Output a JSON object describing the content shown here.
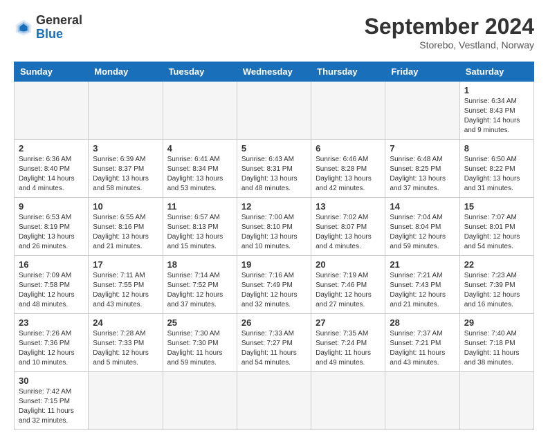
{
  "header": {
    "logo_line1": "General",
    "logo_line2": "Blue",
    "month_title": "September 2024",
    "location": "Storebo, Vestland, Norway"
  },
  "calendar": {
    "days_of_week": [
      "Sunday",
      "Monday",
      "Tuesday",
      "Wednesday",
      "Thursday",
      "Friday",
      "Saturday"
    ],
    "weeks": [
      [
        null,
        null,
        null,
        null,
        null,
        null,
        {
          "day": "1",
          "sunrise": "Sunrise: 6:34 AM",
          "sunset": "Sunset: 8:43 PM",
          "daylight": "Daylight: 14 hours and 9 minutes."
        }
      ],
      [
        {
          "day": "2",
          "sunrise": "Sunrise: 6:36 AM",
          "sunset": "Sunset: 8:40 PM",
          "daylight": "Daylight: 14 hours and 4 minutes."
        },
        {
          "day": "3",
          "sunrise": "Sunrise: 6:39 AM",
          "sunset": "Sunset: 8:37 PM",
          "daylight": "Daylight: 13 hours and 58 minutes."
        },
        {
          "day": "4",
          "sunrise": "Sunrise: 6:41 AM",
          "sunset": "Sunset: 8:34 PM",
          "daylight": "Daylight: 13 hours and 53 minutes."
        },
        {
          "day": "5",
          "sunrise": "Sunrise: 6:43 AM",
          "sunset": "Sunset: 8:31 PM",
          "daylight": "Daylight: 13 hours and 48 minutes."
        },
        {
          "day": "6",
          "sunrise": "Sunrise: 6:46 AM",
          "sunset": "Sunset: 8:28 PM",
          "daylight": "Daylight: 13 hours and 42 minutes."
        },
        {
          "day": "7",
          "sunrise": "Sunrise: 6:48 AM",
          "sunset": "Sunset: 8:25 PM",
          "daylight": "Daylight: 13 hours and 37 minutes."
        },
        {
          "day": "8",
          "sunrise": "Sunrise: 6:50 AM",
          "sunset": "Sunset: 8:22 PM",
          "daylight": "Daylight: 13 hours and 31 minutes."
        }
      ],
      [
        {
          "day": "9",
          "sunrise": "Sunrise: 6:53 AM",
          "sunset": "Sunset: 8:19 PM",
          "daylight": "Daylight: 13 hours and 26 minutes."
        },
        {
          "day": "10",
          "sunrise": "Sunrise: 6:55 AM",
          "sunset": "Sunset: 8:16 PM",
          "daylight": "Daylight: 13 hours and 21 minutes."
        },
        {
          "day": "11",
          "sunrise": "Sunrise: 6:57 AM",
          "sunset": "Sunset: 8:13 PM",
          "daylight": "Daylight: 13 hours and 15 minutes."
        },
        {
          "day": "12",
          "sunrise": "Sunrise: 7:00 AM",
          "sunset": "Sunset: 8:10 PM",
          "daylight": "Daylight: 13 hours and 10 minutes."
        },
        {
          "day": "13",
          "sunrise": "Sunrise: 7:02 AM",
          "sunset": "Sunset: 8:07 PM",
          "daylight": "Daylight: 13 hours and 4 minutes."
        },
        {
          "day": "14",
          "sunrise": "Sunrise: 7:04 AM",
          "sunset": "Sunset: 8:04 PM",
          "daylight": "Daylight: 12 hours and 59 minutes."
        },
        {
          "day": "15",
          "sunrise": "Sunrise: 7:07 AM",
          "sunset": "Sunset: 8:01 PM",
          "daylight": "Daylight: 12 hours and 54 minutes."
        }
      ],
      [
        {
          "day": "16",
          "sunrise": "Sunrise: 7:09 AM",
          "sunset": "Sunset: 7:58 PM",
          "daylight": "Daylight: 12 hours and 48 minutes."
        },
        {
          "day": "17",
          "sunrise": "Sunrise: 7:11 AM",
          "sunset": "Sunset: 7:55 PM",
          "daylight": "Daylight: 12 hours and 43 minutes."
        },
        {
          "day": "18",
          "sunrise": "Sunrise: 7:14 AM",
          "sunset": "Sunset: 7:52 PM",
          "daylight": "Daylight: 12 hours and 37 minutes."
        },
        {
          "day": "19",
          "sunrise": "Sunrise: 7:16 AM",
          "sunset": "Sunset: 7:49 PM",
          "daylight": "Daylight: 12 hours and 32 minutes."
        },
        {
          "day": "20",
          "sunrise": "Sunrise: 7:19 AM",
          "sunset": "Sunset: 7:46 PM",
          "daylight": "Daylight: 12 hours and 27 minutes."
        },
        {
          "day": "21",
          "sunrise": "Sunrise: 7:21 AM",
          "sunset": "Sunset: 7:43 PM",
          "daylight": "Daylight: 12 hours and 21 minutes."
        },
        {
          "day": "22",
          "sunrise": "Sunrise: 7:23 AM",
          "sunset": "Sunset: 7:39 PM",
          "daylight": "Daylight: 12 hours and 16 minutes."
        }
      ],
      [
        {
          "day": "23",
          "sunrise": "Sunrise: 7:26 AM",
          "sunset": "Sunset: 7:36 PM",
          "daylight": "Daylight: 12 hours and 10 minutes."
        },
        {
          "day": "24",
          "sunrise": "Sunrise: 7:28 AM",
          "sunset": "Sunset: 7:33 PM",
          "daylight": "Daylight: 12 hours and 5 minutes."
        },
        {
          "day": "25",
          "sunrise": "Sunrise: 7:30 AM",
          "sunset": "Sunset: 7:30 PM",
          "daylight": "Daylight: 11 hours and 59 minutes."
        },
        {
          "day": "26",
          "sunrise": "Sunrise: 7:33 AM",
          "sunset": "Sunset: 7:27 PM",
          "daylight": "Daylight: 11 hours and 54 minutes."
        },
        {
          "day": "27",
          "sunrise": "Sunrise: 7:35 AM",
          "sunset": "Sunset: 7:24 PM",
          "daylight": "Daylight: 11 hours and 49 minutes."
        },
        {
          "day": "28",
          "sunrise": "Sunrise: 7:37 AM",
          "sunset": "Sunset: 7:21 PM",
          "daylight": "Daylight: 11 hours and 43 minutes."
        },
        {
          "day": "29",
          "sunrise": "Sunrise: 7:40 AM",
          "sunset": "Sunset: 7:18 PM",
          "daylight": "Daylight: 11 hours and 38 minutes."
        }
      ],
      [
        {
          "day": "30",
          "sunrise": "Sunrise: 7:42 AM",
          "sunset": "Sunset: 7:15 PM",
          "daylight": "Daylight: 11 hours and 32 minutes."
        },
        null,
        null,
        null,
        null,
        null,
        null
      ]
    ]
  }
}
